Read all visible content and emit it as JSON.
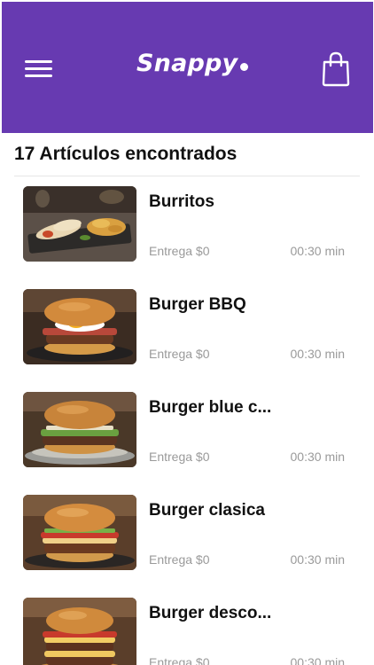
{
  "header": {
    "logo_text": "Snappy",
    "menu_icon": "hamburger-menu-icon",
    "cart_icon": "shopping-bag-icon",
    "background_color": "#673ab1"
  },
  "results": {
    "title": "17 Artículos encontrados"
  },
  "products": [
    {
      "name": "Burritos",
      "delivery": "Entrega $0",
      "time": "00:30 min",
      "image": "burritos-photo"
    },
    {
      "name": "Burger BBQ",
      "delivery": "Entrega $0",
      "time": "00:30 min",
      "image": "burger-bbq-photo"
    },
    {
      "name": "Burger blue c...",
      "delivery": "Entrega $0",
      "time": "00:30 min",
      "image": "burger-blue-cheese-photo"
    },
    {
      "name": "Burger clasica",
      "delivery": "Entrega $0",
      "time": "00:30 min",
      "image": "burger-clasica-photo"
    },
    {
      "name": "Burger desco...",
      "delivery": "Entrega $0",
      "time": "00:30 min",
      "image": "burger-descomunal-photo"
    }
  ]
}
